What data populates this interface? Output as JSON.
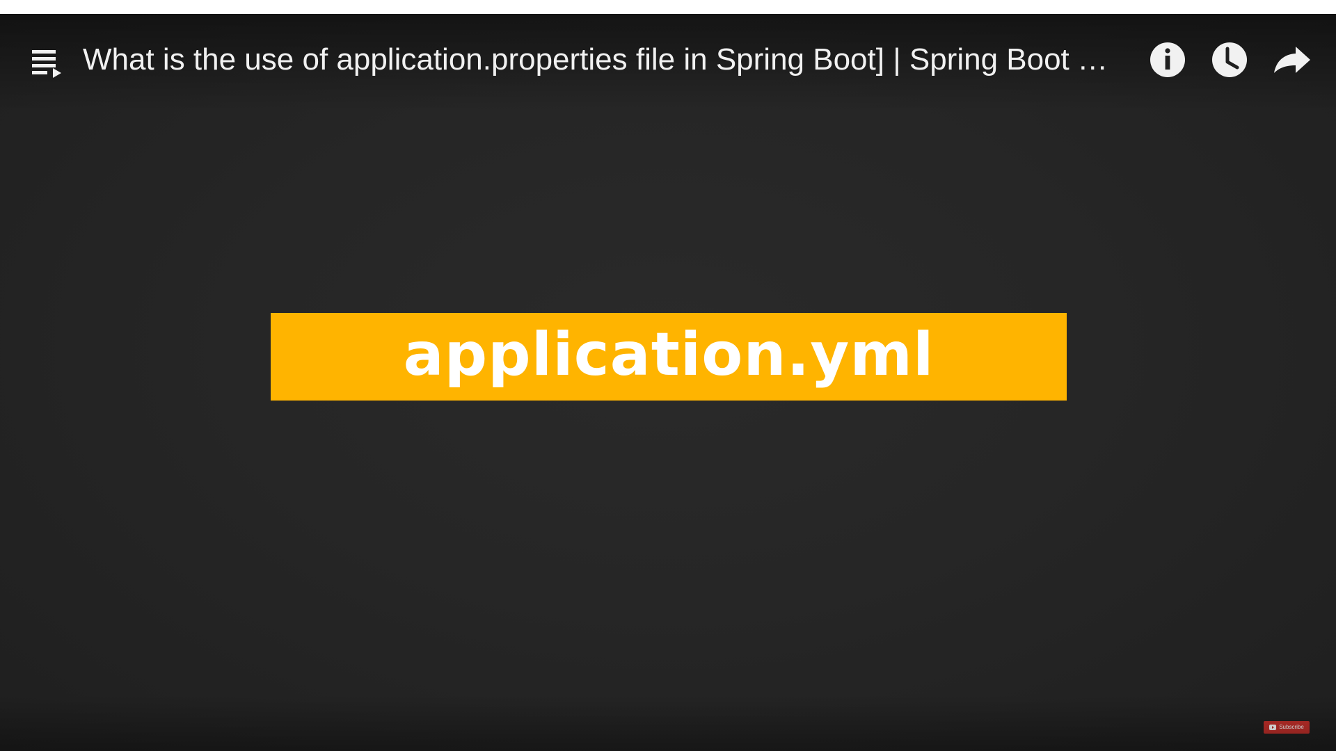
{
  "video": {
    "title": "What is the use of application.properties file in Spring Boot] | Spring Boot T…"
  },
  "overlay_icons": {
    "playlist": "playlist-icon",
    "info": "info-icon",
    "watch_later": "clock-icon",
    "share": "share-icon"
  },
  "frame": {
    "banner_text": "application.yml"
  },
  "watermark": {
    "subscribe_label": "Subscribe"
  },
  "colors": {
    "player_background": "#262626",
    "banner": "#ffb400",
    "banner_text": "#ffffff",
    "title_text": "#f1f1f1",
    "subscribe_badge": "#c4302b"
  }
}
